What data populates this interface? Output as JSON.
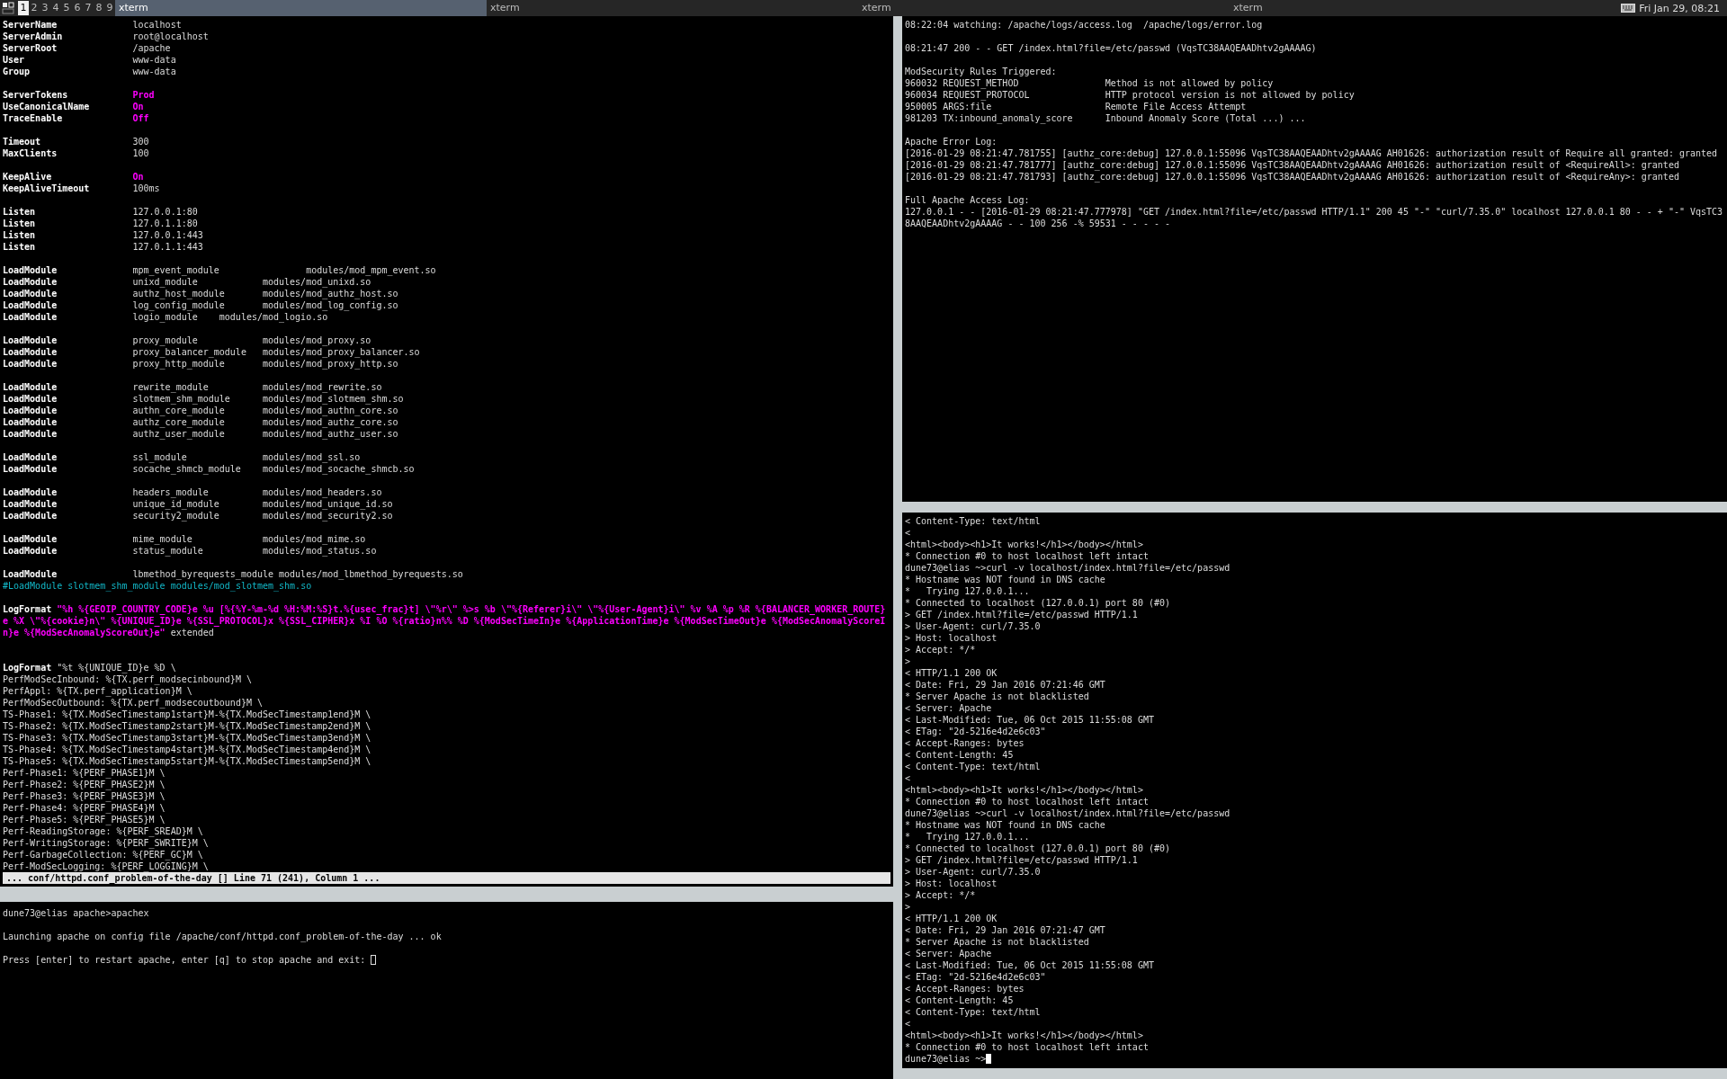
{
  "top_bar": {
    "workspaces": [
      {
        "label": "1",
        "selected": true
      },
      {
        "label": "2",
        "selected": false
      },
      {
        "label": "3",
        "selected": false
      },
      {
        "label": "4",
        "selected": false
      },
      {
        "label": "5",
        "selected": false
      },
      {
        "label": "6",
        "selected": false
      },
      {
        "label": "7",
        "selected": false
      },
      {
        "label": "8",
        "selected": false
      },
      {
        "label": "9",
        "selected": false
      }
    ],
    "tabs": [
      {
        "label": "xterm",
        "selected": true
      },
      {
        "label": "xterm",
        "selected": false
      },
      {
        "label": "xterm",
        "selected": false
      },
      {
        "label": "xterm",
        "selected": false
      }
    ],
    "clock": "Fri Jan 29, 08:21"
  },
  "editor": {
    "lines": [
      {
        "kind": "directive",
        "key": "ServerName",
        "value": "localhost",
        "emphasis": false
      },
      {
        "kind": "directive",
        "key": "ServerAdmin",
        "value": "root@localhost",
        "emphasis": false
      },
      {
        "kind": "directive",
        "key": "ServerRoot",
        "value": "/apache",
        "emphasis": false
      },
      {
        "kind": "directive",
        "key": "User",
        "value": "www-data",
        "emphasis": false
      },
      {
        "kind": "directive",
        "key": "Group",
        "value": "www-data",
        "emphasis": false
      },
      {
        "kind": "blank"
      },
      {
        "kind": "directive",
        "key": "ServerTokens",
        "value": "Prod",
        "emphasis": true
      },
      {
        "kind": "directive",
        "key": "UseCanonicalName",
        "value": "On",
        "emphasis": true
      },
      {
        "kind": "directive",
        "key": "TraceEnable",
        "value": "Off",
        "emphasis": true
      },
      {
        "kind": "blank"
      },
      {
        "kind": "directive",
        "key": "Timeout",
        "value": "300",
        "emphasis": false
      },
      {
        "kind": "directive",
        "key": "MaxClients",
        "value": "100",
        "emphasis": false
      },
      {
        "kind": "blank"
      },
      {
        "kind": "directive",
        "key": "KeepAlive",
        "value": "On",
        "emphasis": true
      },
      {
        "kind": "directive",
        "key": "KeepAliveTimeout",
        "value": "100ms",
        "emphasis": false
      },
      {
        "kind": "blank"
      },
      {
        "kind": "directive",
        "key": "Listen",
        "value": "127.0.0.1:80",
        "emphasis": false
      },
      {
        "kind": "directive",
        "key": "Listen",
        "value": "127.0.1.1:80",
        "emphasis": false
      },
      {
        "kind": "directive",
        "key": "Listen",
        "value": "127.0.0.1:443",
        "emphasis": false
      },
      {
        "kind": "directive",
        "key": "Listen",
        "value": "127.0.1.1:443",
        "emphasis": false
      },
      {
        "kind": "blank"
      },
      {
        "kind": "directive",
        "key": "LoadModule",
        "value": "mpm_event_module                modules/mod_mpm_event.so",
        "emphasis": false
      },
      {
        "kind": "directive",
        "key": "LoadModule",
        "value": "unixd_module            modules/mod_unixd.so",
        "emphasis": false
      },
      {
        "kind": "directive",
        "key": "LoadModule",
        "value": "authz_host_module       modules/mod_authz_host.so",
        "emphasis": false
      },
      {
        "kind": "directive",
        "key": "LoadModule",
        "value": "log_config_module       modules/mod_log_config.so",
        "emphasis": false
      },
      {
        "kind": "directive",
        "key": "LoadModule",
        "value": "logio_module    modules/mod_logio.so",
        "emphasis": false
      },
      {
        "kind": "blank"
      },
      {
        "kind": "directive",
        "key": "LoadModule",
        "value": "proxy_module            modules/mod_proxy.so",
        "emphasis": false
      },
      {
        "kind": "directive",
        "key": "LoadModule",
        "value": "proxy_balancer_module   modules/mod_proxy_balancer.so",
        "emphasis": false
      },
      {
        "kind": "directive",
        "key": "LoadModule",
        "value": "proxy_http_module       modules/mod_proxy_http.so",
        "emphasis": false
      },
      {
        "kind": "blank"
      },
      {
        "kind": "directive",
        "key": "LoadModule",
        "value": "rewrite_module          modules/mod_rewrite.so",
        "emphasis": false
      },
      {
        "kind": "directive",
        "key": "LoadModule",
        "value": "slotmem_shm_module      modules/mod_slotmem_shm.so",
        "emphasis": false
      },
      {
        "kind": "directive",
        "key": "LoadModule",
        "value": "authn_core_module       modules/mod_authn_core.so",
        "emphasis": false
      },
      {
        "kind": "directive",
        "key": "LoadModule",
        "value": "authz_core_module       modules/mod_authz_core.so",
        "emphasis": false
      },
      {
        "kind": "directive",
        "key": "LoadModule",
        "value": "authz_user_module       modules/mod_authz_user.so",
        "emphasis": false
      },
      {
        "kind": "blank"
      },
      {
        "kind": "directive",
        "key": "LoadModule",
        "value": "ssl_module              modules/mod_ssl.so",
        "emphasis": false
      },
      {
        "kind": "directive",
        "key": "LoadModule",
        "value": "socache_shmcb_module    modules/mod_socache_shmcb.so",
        "emphasis": false
      },
      {
        "kind": "blank"
      },
      {
        "kind": "directive",
        "key": "LoadModule",
        "value": "headers_module          modules/mod_headers.so",
        "emphasis": false
      },
      {
        "kind": "directive",
        "key": "LoadModule",
        "value": "unique_id_module        modules/mod_unique_id.so",
        "emphasis": false
      },
      {
        "kind": "directive",
        "key": "LoadModule",
        "value": "security2_module        modules/mod_security2.so",
        "emphasis": false
      },
      {
        "kind": "blank"
      },
      {
        "kind": "directive",
        "key": "LoadModule",
        "value": "mime_module             modules/mod_mime.so",
        "emphasis": false
      },
      {
        "kind": "directive",
        "key": "LoadModule",
        "value": "status_module           modules/mod_status.so",
        "emphasis": false
      },
      {
        "kind": "blank"
      },
      {
        "kind": "directive",
        "key": "LoadModule",
        "value": "lbmethod_byrequests_module modules/mod_lbmethod_byrequests.so",
        "emphasis": false
      },
      {
        "kind": "comment",
        "text": "#LoadModule slotmem_shm_module modules/mod_slotmem_shm.so"
      },
      {
        "kind": "blank"
      },
      {
        "kind": "format",
        "key": "LogFormat",
        "format": "\"%h %{GEOIP_COUNTRY_CODE}e %u [%{%Y-%m-%d %H:%M:%S}t.%{usec_frac}t] \\\"%r\\\" %>s %b \\\"%{Referer}i\\\" \\\"%{User-Agent}i\\\" %v %A %p %R %{BALANCER_WORKER_ROUTE}e %X \\\"%{cookie}n\\\" %{UNIQUE_ID}e %{SSL_PROTOCOL}x %{SSL_CIPHER}x %I %O %{ratio}n%% %D %{ModSecTimeIn}e %{ApplicationTime}e %{ModSecTimeOut}e %{ModSecAnomalyScoreIn}e %{ModSecAnomalyScoreOut}e\"",
        "suffix": "extended"
      },
      {
        "kind": "blank"
      },
      {
        "kind": "blank"
      },
      {
        "kind": "inline",
        "key": "LogFormat",
        "value": "\"%t %{UNIQUE_ID}e %D \\"
      },
      {
        "kind": "text",
        "text": "PerfModSecInbound: %{TX.perf_modsecinbound}M \\"
      },
      {
        "kind": "text",
        "text": "PerfAppl: %{TX.perf_application}M \\"
      },
      {
        "kind": "text",
        "text": "PerfModSecOutbound: %{TX.perf_modsecoutbound}M \\"
      },
      {
        "kind": "text",
        "text": "TS-Phase1: %{TX.ModSecTimestamp1start}M-%{TX.ModSecTimestamp1end}M \\"
      },
      {
        "kind": "text",
        "text": "TS-Phase2: %{TX.ModSecTimestamp2start}M-%{TX.ModSecTimestamp2end}M \\"
      },
      {
        "kind": "text",
        "text": "TS-Phase3: %{TX.ModSecTimestamp3start}M-%{TX.ModSecTimestamp3end}M \\"
      },
      {
        "kind": "text",
        "text": "TS-Phase4: %{TX.ModSecTimestamp4start}M-%{TX.ModSecTimestamp4end}M \\"
      },
      {
        "kind": "text",
        "text": "TS-Phase5: %{TX.ModSecTimestamp5start}M-%{TX.ModSecTimestamp5end}M \\"
      },
      {
        "kind": "text",
        "text": "Perf-Phase1: %{PERF_PHASE1}M \\"
      },
      {
        "kind": "text",
        "text": "Perf-Phase2: %{PERF_PHASE2}M \\"
      },
      {
        "kind": "text",
        "text": "Perf-Phase3: %{PERF_PHASE3}M \\"
      },
      {
        "kind": "text",
        "text": "Perf-Phase4: %{PERF_PHASE4}M \\"
      },
      {
        "kind": "text",
        "text": "Perf-Phase5: %{PERF_PHASE5}M \\"
      },
      {
        "kind": "text",
        "text": "Perf-ReadingStorage: %{PERF_SREAD}M \\"
      },
      {
        "kind": "text",
        "text": "Perf-WritingStorage: %{PERF_SWRITE}M \\"
      },
      {
        "kind": "text",
        "text": "Perf-GarbageCollection: %{PERF_GC}M \\"
      },
      {
        "kind": "text",
        "text": "Perf-ModSecLogging: %{PERF_LOGGING}M \\"
      }
    ],
    "status_line": "... conf/httpd.conf_problem-of-the-day [] Line 71 (241), Column 1 ..."
  },
  "shell": {
    "lines": [
      {
        "kind": "text",
        "text": "dune73@elias apache>apachex"
      },
      {
        "kind": "blank"
      },
      {
        "kind": "text",
        "text": "Launching apache on config file /apache/conf/httpd.conf_problem-of-the-day ... ok"
      },
      {
        "kind": "blank"
      },
      {
        "kind": "text",
        "text": "Press [enter] to restart apache, enter [q] to stop apache and exit: "
      }
    ]
  },
  "watch_log": {
    "lines": [
      {
        "kind": "text",
        "text": "08:22:04 watching: /apache/logs/access.log  /apache/logs/error.log"
      },
      {
        "kind": "blank"
      },
      {
        "kind": "text",
        "text": "08:21:47 200 - - GET /index.html?file=/etc/passwd (VqsTC38AAQEAADhtv2gAAAAG)"
      },
      {
        "kind": "blank"
      },
      {
        "kind": "text",
        "text": "ModSecurity Rules Triggered:"
      },
      {
        "kind": "rule",
        "rule": "960032 REQUEST_METHOD",
        "message": "Method is not allowed by policy"
      },
      {
        "kind": "rule",
        "rule": "960034 REQUEST_PROTOCOL",
        "message": "HTTP protocol version is not allowed by policy"
      },
      {
        "kind": "rule",
        "rule": "950005 ARGS:file",
        "message": "Remote File Access Attempt"
      },
      {
        "kind": "rule",
        "rule": "981203 TX:inbound_anomaly_score",
        "message": "Inbound Anomaly Score (Total ...) ..."
      },
      {
        "kind": "blank"
      },
      {
        "kind": "text",
        "text": "Apache Error Log:"
      },
      {
        "kind": "text",
        "text": "[2016-01-29 08:21:47.781755] [authz_core:debug] 127.0.0.1:55096 VqsTC38AAQEAADhtv2gAAAAG AH01626: authorization result of Require all granted: granted"
      },
      {
        "kind": "text",
        "text": "[2016-01-29 08:21:47.781777] [authz_core:debug] 127.0.0.1:55096 VqsTC38AAQEAADhtv2gAAAAG AH01626: authorization result of <RequireAll>: granted"
      },
      {
        "kind": "text",
        "text": "[2016-01-29 08:21:47.781793] [authz_core:debug] 127.0.0.1:55096 VqsTC38AAQEAADhtv2gAAAAG AH01626: authorization result of <RequireAny>: granted"
      },
      {
        "kind": "blank"
      },
      {
        "kind": "text",
        "text": "Full Apache Access Log:"
      },
      {
        "kind": "text",
        "text": "127.0.0.1 - - [2016-01-29 08:21:47.777978] \"GET /index.html?file=/etc/passwd HTTP/1.1\" 200 45 \"-\" \"curl/7.35.0\" localhost 127.0.0.1 80 - - + \"-\" VqsTC38AAQEAADhtv2gAAAAG - - 100 256 -% 59531 - - - - -"
      }
    ]
  },
  "curl_terminal": {
    "lines": [
      "< Content-Type: text/html",
      "<",
      "<html><body><h1>It works!</h1></body></html>",
      "* Connection #0 to host localhost left intact",
      "dune73@elias ~>curl -v localhost/index.html?file=/etc/passwd",
      "* Hostname was NOT found in DNS cache",
      "*   Trying 127.0.0.1...",
      "* Connected to localhost (127.0.0.1) port 80 (#0)",
      "> GET /index.html?file=/etc/passwd HTTP/1.1",
      "> User-Agent: curl/7.35.0",
      "> Host: localhost",
      "> Accept: */*",
      ">",
      "< HTTP/1.1 200 OK",
      "< Date: Fri, 29 Jan 2016 07:21:46 GMT",
      "* Server Apache is not blacklisted",
      "< Server: Apache",
      "< Last-Modified: Tue, 06 Oct 2015 11:55:08 GMT",
      "< ETag: \"2d-5216e4d2e6c03\"",
      "< Accept-Ranges: bytes",
      "< Content-Length: 45",
      "< Content-Type: text/html",
      "<",
      "<html><body><h1>It works!</h1></body></html>",
      "* Connection #0 to host localhost left intact",
      "dune73@elias ~>curl -v localhost/index.html?file=/etc/passwd",
      "* Hostname was NOT found in DNS cache",
      "*   Trying 127.0.0.1...",
      "* Connected to localhost (127.0.0.1) port 80 (#0)",
      "> GET /index.html?file=/etc/passwd HTTP/1.1",
      "> User-Agent: curl/7.35.0",
      "> Host: localhost",
      "> Accept: */*",
      ">",
      "< HTTP/1.1 200 OK",
      "< Date: Fri, 29 Jan 2016 07:21:47 GMT",
      "* Server Apache is not blacklisted",
      "< Server: Apache",
      "< Last-Modified: Tue, 06 Oct 2015 11:55:08 GMT",
      "< ETag: \"2d-5216e4d2e6c03\"",
      "< Accept-Ranges: bytes",
      "< Content-Length: 45",
      "< Content-Type: text/html",
      "<",
      "<html><body><h1>It works!</h1></body></html>",
      "* Connection #0 to host localhost left intact",
      "dune73@elias ~>"
    ]
  }
}
